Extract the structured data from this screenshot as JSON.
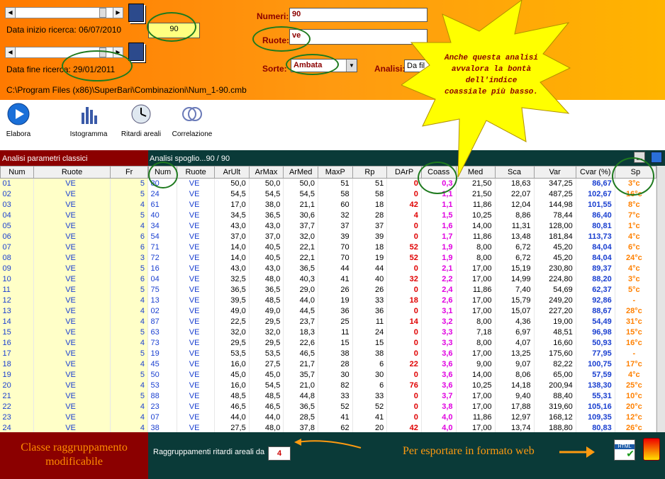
{
  "top": {
    "start_label": "Data inizio ricerca: 06/07/2010",
    "end_label": "Data fine ricerca: 29/01/2011",
    "value_box": "90",
    "numeri_label": "Numeri:",
    "numeri_value": "90",
    "ruote_label": "Ruote:",
    "ruote_value": "ve",
    "sorte_label": "Sorte:",
    "sorte_value": "Ambata",
    "analisi_label": "Analisi:",
    "analisi_value": "Da fil",
    "path": "C:\\Program Files (x86)\\SuperBari\\Combinazioni\\Num_1-90.cmb"
  },
  "toolbar": {
    "elabora": "Elabora",
    "istogramma": "Istogramma",
    "ritardi": "Ritardi areali",
    "correlazione": "Correlazione"
  },
  "callout": "Anche questa analisi avvalora la bontà dell'indice coassiale più basso.",
  "left_panel": {
    "title": "Analisi parametri classici",
    "headers": [
      "Num",
      "Ruote",
      "Fr"
    ],
    "rows": [
      [
        "01",
        "VE",
        "5"
      ],
      [
        "02",
        "VE",
        "5"
      ],
      [
        "03",
        "VE",
        "4"
      ],
      [
        "04",
        "VE",
        "5"
      ],
      [
        "05",
        "VE",
        "4"
      ],
      [
        "06",
        "VE",
        "6"
      ],
      [
        "07",
        "VE",
        "6"
      ],
      [
        "08",
        "VE",
        "3"
      ],
      [
        "09",
        "VE",
        "5"
      ],
      [
        "10",
        "VE",
        "6"
      ],
      [
        "11",
        "VE",
        "5"
      ],
      [
        "12",
        "VE",
        "4"
      ],
      [
        "13",
        "VE",
        "4"
      ],
      [
        "14",
        "VE",
        "4"
      ],
      [
        "15",
        "VE",
        "5"
      ],
      [
        "16",
        "VE",
        "4"
      ],
      [
        "17",
        "VE",
        "5"
      ],
      [
        "18",
        "VE",
        "4"
      ],
      [
        "19",
        "VE",
        "5"
      ],
      [
        "20",
        "VE",
        "4"
      ],
      [
        "21",
        "VE",
        "5"
      ],
      [
        "22",
        "VE",
        "4"
      ],
      [
        "23",
        "VE",
        "4"
      ],
      [
        "24",
        "VE",
        "4"
      ]
    ]
  },
  "right_panel": {
    "title": "Analisi spoglio...90 / 90",
    "headers": [
      "Num",
      "Ruote",
      "ArUlt",
      "ArMax",
      "ArMed",
      "MaxP",
      "Rp",
      "DArP",
      "Coass",
      "Med",
      "Sca",
      "Var",
      "Cvar (%)",
      "Sp"
    ],
    "rows": [
      [
        "80",
        "VE",
        "50,0",
        "50,0",
        "50,0",
        "51",
        "51",
        "0",
        "0,3",
        "21,50",
        "18,63",
        "347,25",
        "86,67",
        "3°c"
      ],
      [
        "24",
        "VE",
        "54,5",
        "54,5",
        "54,5",
        "58",
        "58",
        "0",
        "1,1",
        "21,50",
        "22,07",
        "487,25",
        "102,67",
        "16°c"
      ],
      [
        "61",
        "VE",
        "17,0",
        "38,0",
        "21,1",
        "60",
        "18",
        "42",
        "1,1",
        "11,86",
        "12,04",
        "144,98",
        "101,55",
        "8°c"
      ],
      [
        "40",
        "VE",
        "34,5",
        "36,5",
        "30,6",
        "32",
        "28",
        "4",
        "1,5",
        "10,25",
        "8,86",
        "78,44",
        "86,40",
        "7°c"
      ],
      [
        "34",
        "VE",
        "43,0",
        "43,0",
        "37,7",
        "37",
        "37",
        "0",
        "1,6",
        "14,00",
        "11,31",
        "128,00",
        "80,81",
        "1°c"
      ],
      [
        "54",
        "VE",
        "37,0",
        "37,0",
        "32,0",
        "39",
        "39",
        "0",
        "1,7",
        "11,86",
        "13,48",
        "181,84",
        "113,73",
        "4°c"
      ],
      [
        "71",
        "VE",
        "14,0",
        "40,5",
        "22,1",
        "70",
        "18",
        "52",
        "1,9",
        "8,00",
        "6,72",
        "45,20",
        "84,04",
        "6°c"
      ],
      [
        "72",
        "VE",
        "14,0",
        "40,5",
        "22,1",
        "70",
        "19",
        "52",
        "1,9",
        "8,00",
        "6,72",
        "45,20",
        "84,04",
        "24°c"
      ],
      [
        "16",
        "VE",
        "43,0",
        "43,0",
        "36,5",
        "44",
        "44",
        "0",
        "2,1",
        "17,00",
        "15,19",
        "230,80",
        "89,37",
        "4°c"
      ],
      [
        "04",
        "VE",
        "32,5",
        "48,0",
        "40,3",
        "41",
        "40",
        "32",
        "2,2",
        "17,00",
        "14,99",
        "224,80",
        "88,20",
        "3°c"
      ],
      [
        "75",
        "VE",
        "36,5",
        "36,5",
        "29,0",
        "26",
        "26",
        "0",
        "2,4",
        "11,86",
        "7,40",
        "54,69",
        "62,37",
        "5°c"
      ],
      [
        "13",
        "VE",
        "39,5",
        "48,5",
        "44,0",
        "19",
        "33",
        "18",
        "2,6",
        "17,00",
        "15,79",
        "249,20",
        "92,86",
        "-"
      ],
      [
        "02",
        "VE",
        "49,0",
        "49,0",
        "44,5",
        "36",
        "36",
        "0",
        "3,1",
        "17,00",
        "15,07",
        "227,20",
        "88,67",
        "28°c"
      ],
      [
        "87",
        "VE",
        "22,5",
        "29,5",
        "23,7",
        "25",
        "11",
        "14",
        "3,2",
        "8,00",
        "4,36",
        "19,00",
        "54,49",
        "31°c"
      ],
      [
        "63",
        "VE",
        "32,0",
        "32,0",
        "18,3",
        "11",
        "24",
        "0",
        "3,3",
        "7,18",
        "6,97",
        "48,51",
        "96,98",
        "15°c"
      ],
      [
        "73",
        "VE",
        "29,5",
        "29,5",
        "22,6",
        "15",
        "15",
        "0",
        "3,3",
        "8,00",
        "4,07",
        "16,60",
        "50,93",
        "16°c"
      ],
      [
        "19",
        "VE",
        "53,5",
        "53,5",
        "46,5",
        "38",
        "38",
        "0",
        "3,6",
        "17,00",
        "13,25",
        "175,60",
        "77,95",
        "-"
      ],
      [
        "45",
        "VE",
        "16,0",
        "27,5",
        "21,7",
        "28",
        "6",
        "22",
        "3,6",
        "9,00",
        "9,07",
        "82,22",
        "100,75",
        "17°c"
      ],
      [
        "50",
        "VE",
        "45,0",
        "45,0",
        "35,7",
        "30",
        "30",
        "0",
        "3,6",
        "14,00",
        "8,06",
        "65,00",
        "57,59",
        "4°c"
      ],
      [
        "53",
        "VE",
        "16,0",
        "54,5",
        "21,0",
        "82",
        "6",
        "76",
        "3,6",
        "10,25",
        "14,18",
        "200,94",
        "138,30",
        "25°c"
      ],
      [
        "88",
        "VE",
        "48,5",
        "48,5",
        "44,8",
        "33",
        "33",
        "0",
        "3,7",
        "17,00",
        "9,40",
        "88,40",
        "55,31",
        "10°c"
      ],
      [
        "23",
        "VE",
        "46,5",
        "46,5",
        "36,5",
        "52",
        "52",
        "0",
        "3,8",
        "17,00",
        "17,88",
        "319,60",
        "105,16",
        "20°c"
      ],
      [
        "07",
        "VE",
        "44,0",
        "44,0",
        "28,5",
        "41",
        "41",
        "0",
        "4,0",
        "11,86",
        "12,97",
        "168,12",
        "109,35",
        "12°c"
      ],
      [
        "38",
        "VE",
        "27,5",
        "48,0",
        "37,8",
        "62",
        "20",
        "42",
        "4,0",
        "17,00",
        "13,74",
        "188,80",
        "80,83",
        "26°c"
      ]
    ]
  },
  "bottom": {
    "left_note": "Classe raggruppamento modificabile",
    "group_label": "Raggruppamenti ritardi areali da",
    "group_value": "4",
    "export_note": "Per esportare in formato web"
  }
}
